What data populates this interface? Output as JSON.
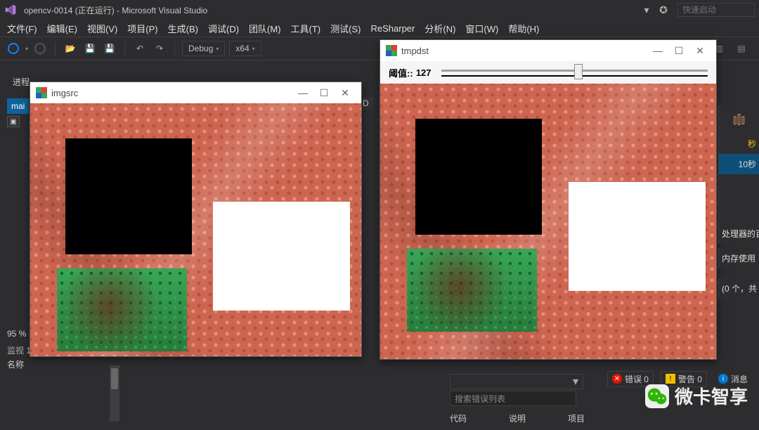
{
  "title": "opencv-0014 (正在运行) - Microsoft Visual Studio",
  "quick_launch_placeholder": "快速启动",
  "menu": [
    "文件(F)",
    "编辑(E)",
    "视图(V)",
    "项目(P)",
    "生成(B)",
    "调试(D)",
    "团队(M)",
    "工具(T)",
    "测试(S)",
    "ReSharper",
    "分析(N)",
    "窗口(W)",
    "帮助(H)"
  ],
  "toolbar": {
    "config": "Debug",
    "platform": "x64",
    "label_D": "D"
  },
  "process_label": "进程",
  "main_tab": "mai",
  "windows": {
    "src": {
      "title": "imgsrc"
    },
    "dst": {
      "title": "tmpdst",
      "trackbar_label": "阈值::",
      "trackbar_value": "127"
    }
  },
  "right_panel": {
    "icon_label": "",
    "ten_sec": "10秒",
    "proc": "处理器的百",
    "mem": "内存使用",
    "gc": "(0 个，共"
  },
  "percent_label": "95 %",
  "watch": {
    "header": "监视 1",
    "col": "名称"
  },
  "errors": {
    "err": "错误 0",
    "warn": "警告 0",
    "msg": "消息",
    "search": "搜索错误列表",
    "cols": [
      "代码",
      "说明",
      "项目"
    ]
  },
  "watermark": "微卡智享"
}
